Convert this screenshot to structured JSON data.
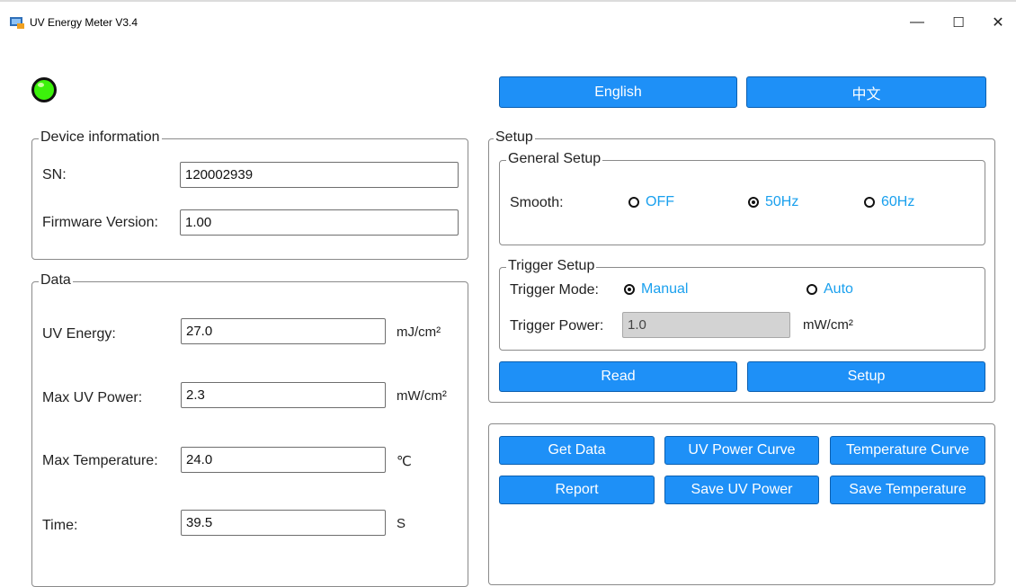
{
  "window": {
    "title": "UV Energy Meter V3.4",
    "controls": {
      "minimize": "—",
      "maximize": "☐",
      "close": "✕"
    }
  },
  "status": {
    "led_color": "#3cf20b"
  },
  "language": {
    "english": "English",
    "chinese": "中文"
  },
  "device_info": {
    "title": "Device information",
    "sn_label": "SN:",
    "sn_value": "120002939",
    "firmware_label": "Firmware Version:",
    "firmware_value": "1.00"
  },
  "data": {
    "title": "Data",
    "uv_energy_label": "UV Energy:",
    "uv_energy_value": "27.0",
    "uv_energy_unit": "mJ/cm²",
    "max_uv_power_label": "Max UV Power:",
    "max_uv_power_value": "2.3",
    "max_uv_power_unit": "mW/cm²",
    "max_temp_label": "Max Temperature:",
    "max_temp_value": "24.0",
    "max_temp_unit": "℃",
    "time_label": "Time:",
    "time_value": "39.5",
    "time_unit": "S"
  },
  "setup": {
    "title": "Setup",
    "general": {
      "title": "General Setup",
      "smooth_label": "Smooth:",
      "options": [
        "OFF",
        "50Hz",
        "60Hz"
      ],
      "selected": "50Hz"
    },
    "trigger": {
      "title": "Trigger Setup",
      "mode_label": "Trigger Mode:",
      "mode_manual": "Manual",
      "mode_auto": "Auto",
      "selected": "Manual",
      "power_label": "Trigger Power:",
      "power_value": "1.0",
      "power_unit": "mW/cm²"
    },
    "read_button": "Read",
    "setup_button": "Setup"
  },
  "actions": {
    "get_data": "Get Data",
    "uv_power_curve": "UV Power Curve",
    "temperature_curve": "Temperature Curve",
    "report": "Report",
    "save_uv_power": "Save UV Power",
    "save_temperature": "Save Temperature"
  },
  "colors": {
    "button_blue": "#1e90f7",
    "radio_text": "#1aa0ee"
  }
}
